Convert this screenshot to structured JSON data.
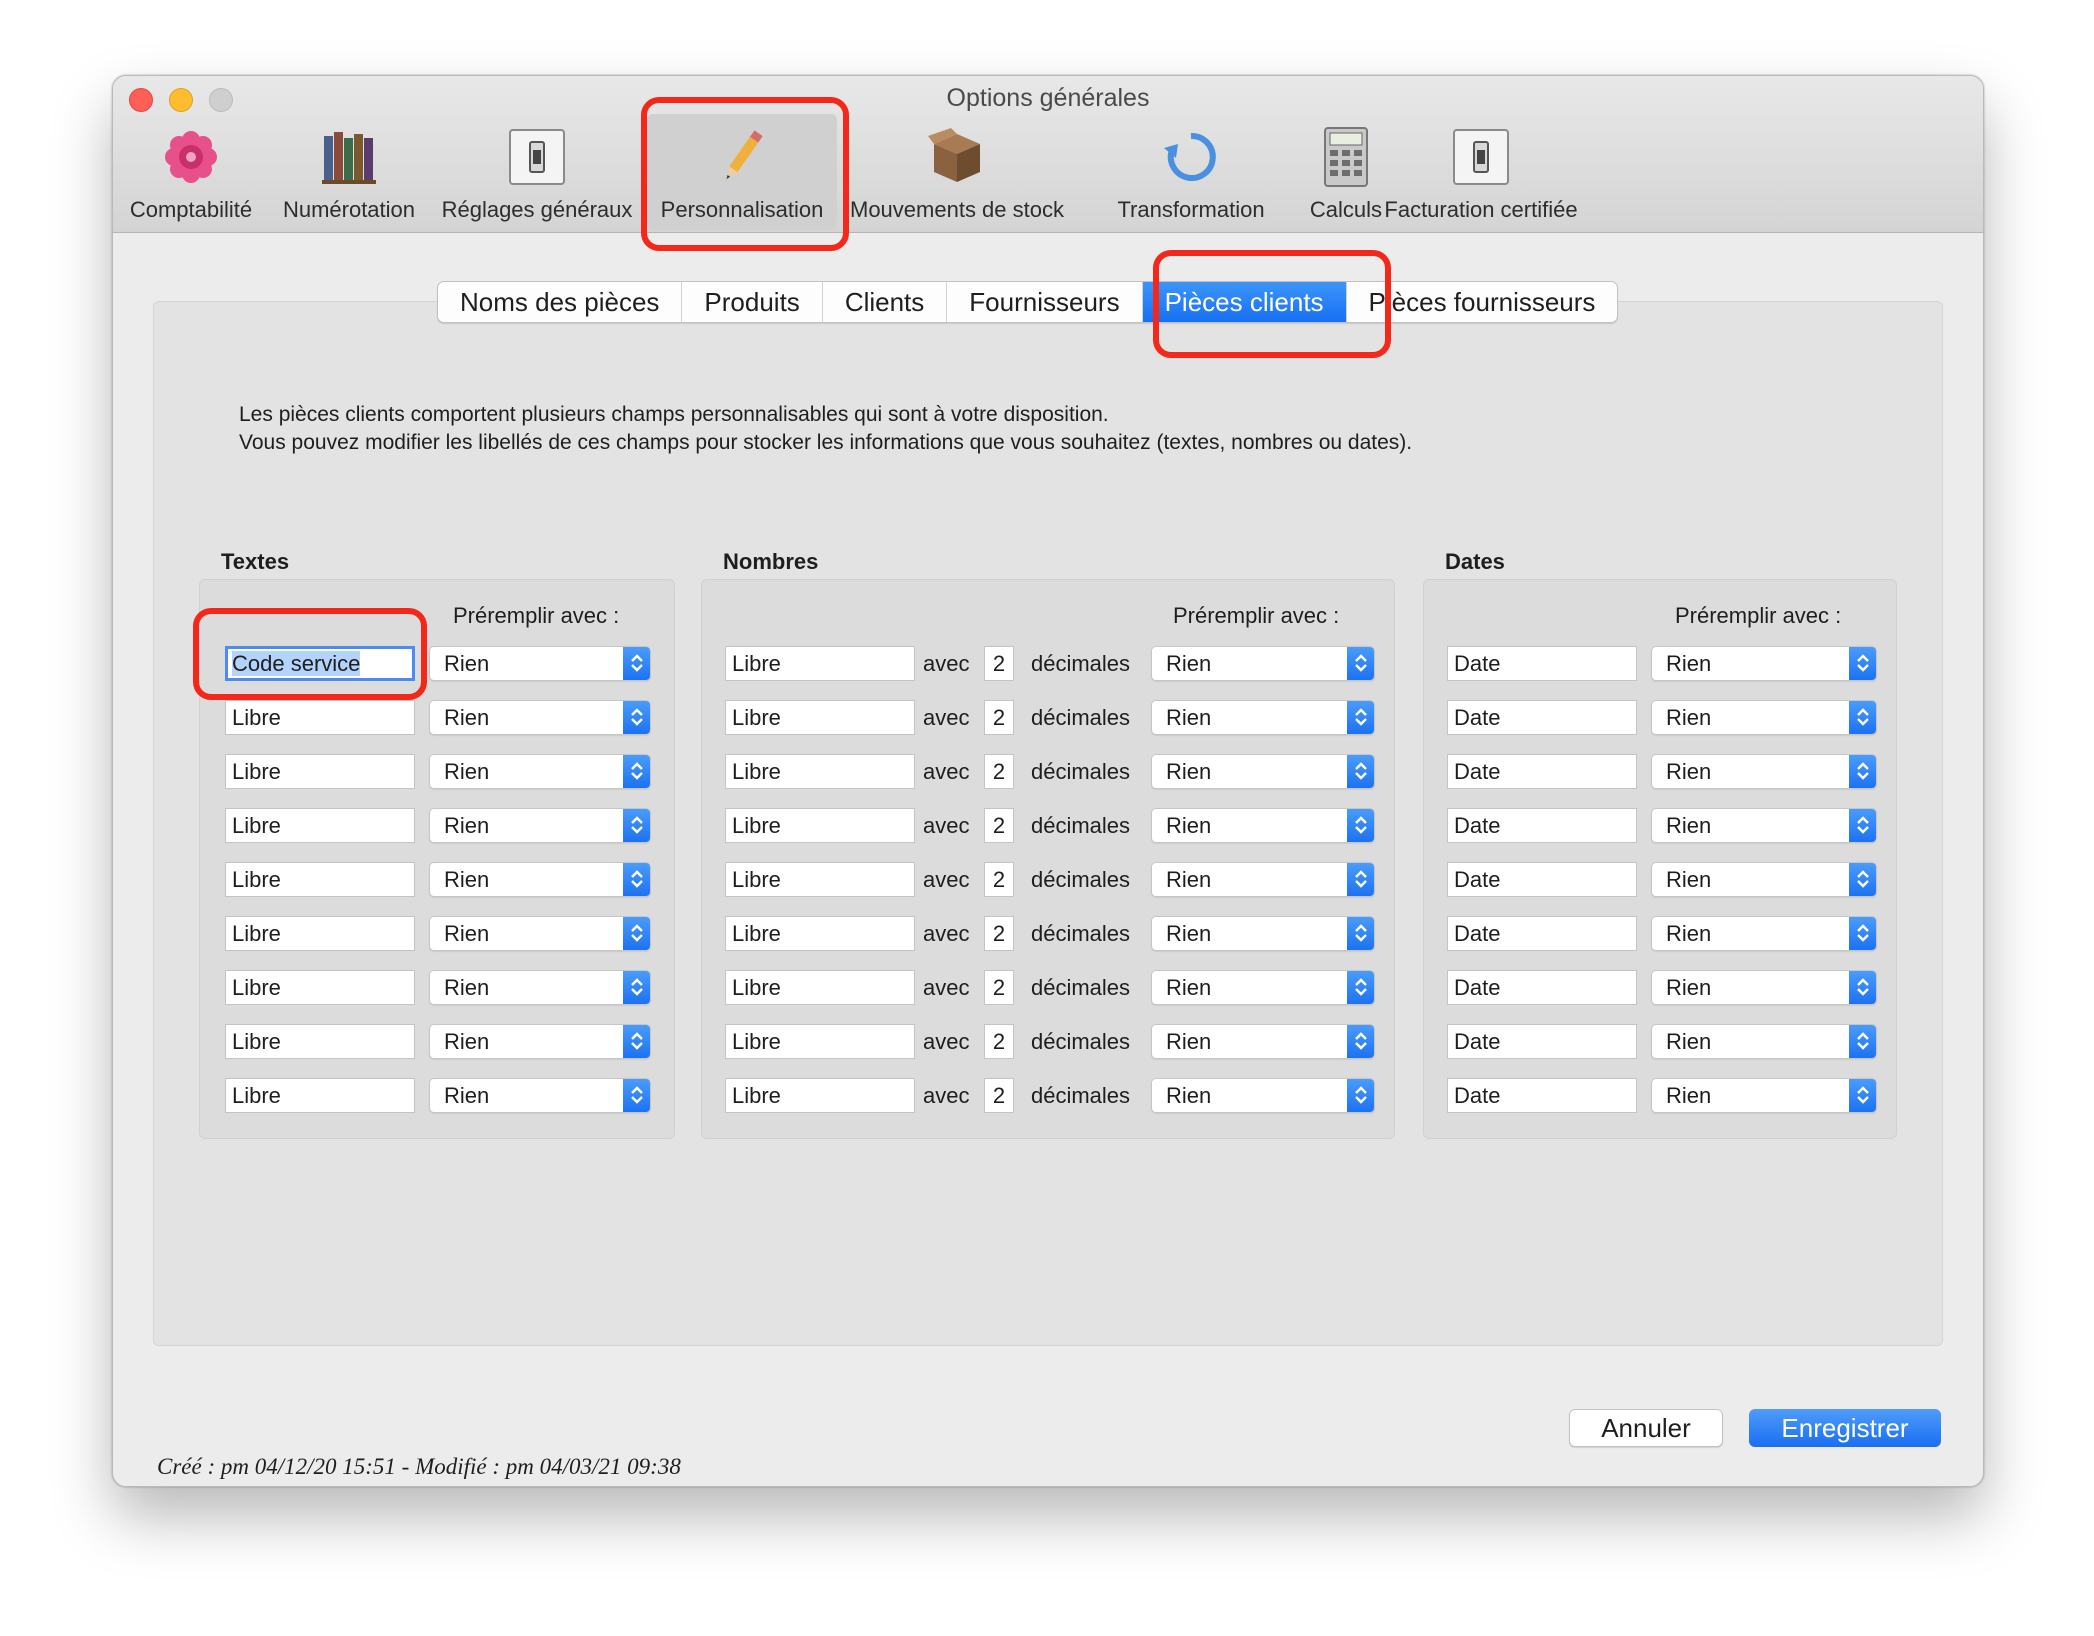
{
  "window": {
    "title": "Options générales"
  },
  "toolbar": {
    "items": [
      {
        "label": "Comptabilité",
        "icon": "flower-icon"
      },
      {
        "label": "Numérotation",
        "icon": "books-icon"
      },
      {
        "label": "Réglages généraux",
        "icon": "switch-icon"
      },
      {
        "label": "Personnalisation",
        "icon": "pencil-icon"
      },
      {
        "label": "Mouvements de stock",
        "icon": "box-icon"
      },
      {
        "label": "Transformation",
        "icon": "refresh-icon"
      },
      {
        "label": "Calculs",
        "icon": "calculator-icon"
      },
      {
        "label": "Facturation certifiée",
        "icon": "switch-icon"
      }
    ],
    "selected": "Personnalisation"
  },
  "tabs": {
    "items": [
      "Noms des pièces",
      "Produits",
      "Clients",
      "Fournisseurs",
      "Pièces clients",
      "Pièces fournisseurs"
    ],
    "active": "Pièces clients"
  },
  "description": {
    "line1": "Les pièces clients comportent plusieurs champs personnalisables qui sont à votre disposition.",
    "line2": "Vous pouvez modifier les libellés de ces champs pour stocker les informations que vous souhaitez (textes, nombres ou dates)."
  },
  "sections": {
    "textes": {
      "title": "Textes",
      "prefill_label": "Préremplir avec :",
      "rows": [
        {
          "label": "Code service",
          "prefill": "Rien"
        },
        {
          "label": "Libre",
          "prefill": "Rien"
        },
        {
          "label": "Libre",
          "prefill": "Rien"
        },
        {
          "label": "Libre",
          "prefill": "Rien"
        },
        {
          "label": "Libre",
          "prefill": "Rien"
        },
        {
          "label": "Libre",
          "prefill": "Rien"
        },
        {
          "label": "Libre",
          "prefill": "Rien"
        },
        {
          "label": "Libre",
          "prefill": "Rien"
        },
        {
          "label": "Libre",
          "prefill": "Rien"
        }
      ]
    },
    "nombres": {
      "title": "Nombres",
      "prefill_label": "Préremplir avec :",
      "avec_label": "avec",
      "decimales_label": "décimales",
      "rows": [
        {
          "label": "Libre",
          "decimals": "2",
          "prefill": "Rien"
        },
        {
          "label": "Libre",
          "decimals": "2",
          "prefill": "Rien"
        },
        {
          "label": "Libre",
          "decimals": "2",
          "prefill": "Rien"
        },
        {
          "label": "Libre",
          "decimals": "2",
          "prefill": "Rien"
        },
        {
          "label": "Libre",
          "decimals": "2",
          "prefill": "Rien"
        },
        {
          "label": "Libre",
          "decimals": "2",
          "prefill": "Rien"
        },
        {
          "label": "Libre",
          "decimals": "2",
          "prefill": "Rien"
        },
        {
          "label": "Libre",
          "decimals": "2",
          "prefill": "Rien"
        },
        {
          "label": "Libre",
          "decimals": "2",
          "prefill": "Rien"
        }
      ]
    },
    "dates": {
      "title": "Dates",
      "prefill_label": "Préremplir avec :",
      "rows": [
        {
          "label": "Date",
          "prefill": "Rien"
        },
        {
          "label": "Date",
          "prefill": "Rien"
        },
        {
          "label": "Date",
          "prefill": "Rien"
        },
        {
          "label": "Date",
          "prefill": "Rien"
        },
        {
          "label": "Date",
          "prefill": "Rien"
        },
        {
          "label": "Date",
          "prefill": "Rien"
        },
        {
          "label": "Date",
          "prefill": "Rien"
        },
        {
          "label": "Date",
          "prefill": "Rien"
        },
        {
          "label": "Date",
          "prefill": "Rien"
        }
      ]
    }
  },
  "buttons": {
    "cancel": "Annuler",
    "save": "Enregistrer"
  },
  "status": "Créé : pm 04/12/20 15:51 - Modifié : pm 04/03/21 09:38",
  "colors": {
    "accent": "#1670f2",
    "highlight": "#f3281a"
  }
}
